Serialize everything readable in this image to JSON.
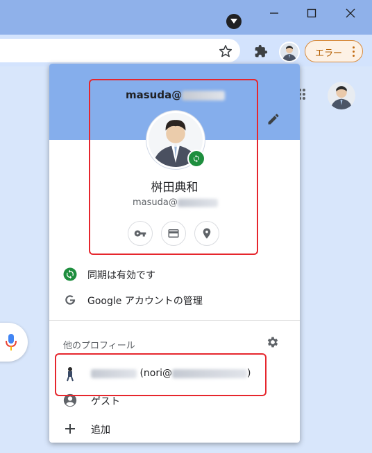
{
  "toolbar": {
    "error_label": "エラー"
  },
  "profile_menu": {
    "header_email": "masuda@",
    "profile_name": "桝田典和",
    "profile_email": "masuda@",
    "sync_status": "同期は有効です",
    "manage_account": "Google アカウントの管理",
    "other_profiles_title": "他のプロフィール",
    "other_profile_email": "(nori@",
    "other_profile_close": ")",
    "guest": "ゲスト",
    "add": "追加"
  },
  "colors": {
    "header_bg": "#85aeec",
    "titlebar_bg": "#8fb1ea",
    "sync_green": "#1e8e3e",
    "error_orange": "#d88a3b",
    "highlight_red": "#e6262d"
  },
  "icons": [
    "chevron-down-icon",
    "minimize-icon",
    "maximize-icon",
    "close-icon",
    "star-icon",
    "puzzle-icon",
    "more-vert-icon",
    "apps-grid-icon",
    "mic-icon",
    "pencil-icon",
    "sync-icon",
    "key-icon",
    "card-icon",
    "location-icon",
    "google-g-icon",
    "gear-icon",
    "guest-icon",
    "plus-icon"
  ]
}
